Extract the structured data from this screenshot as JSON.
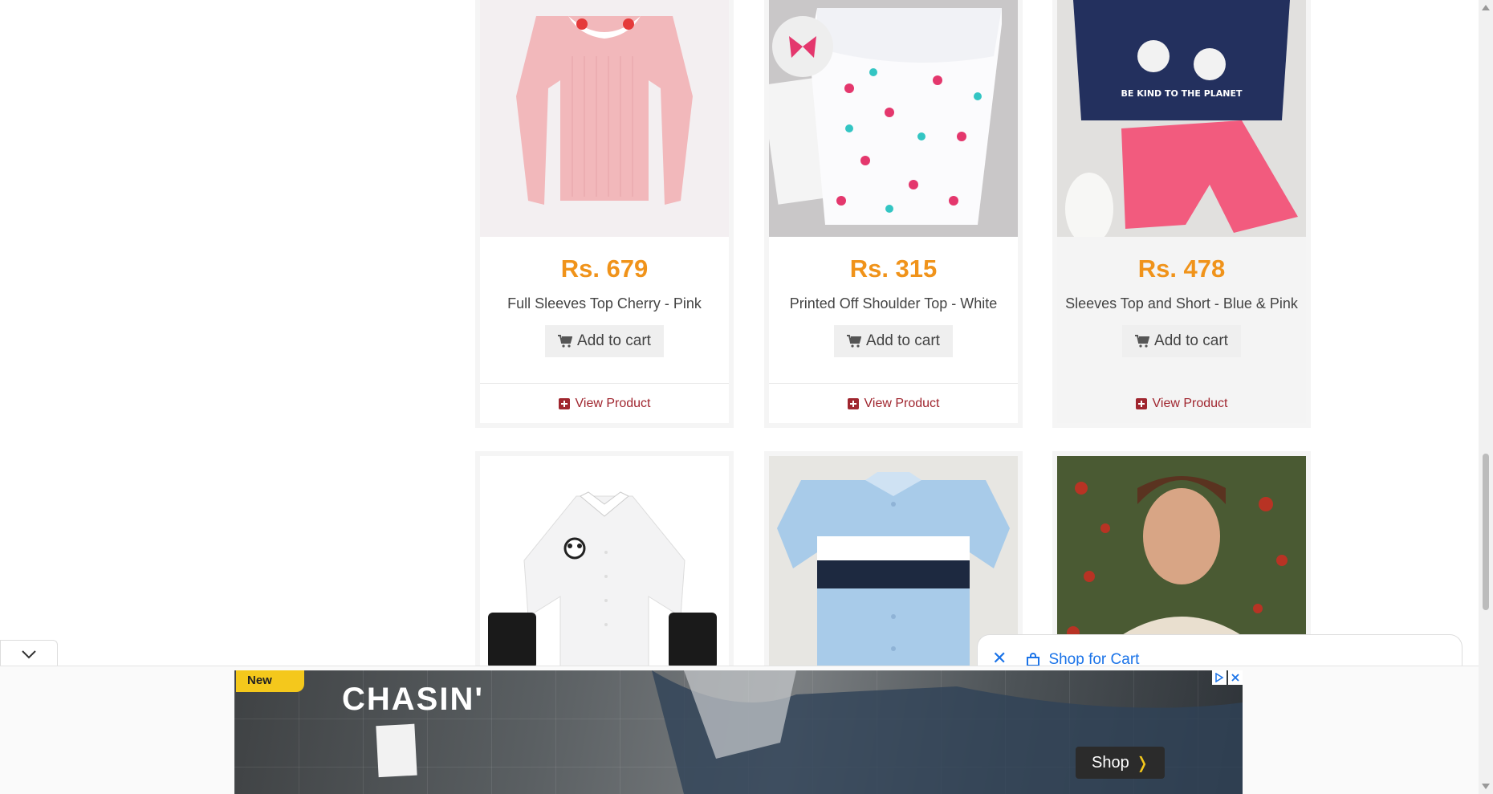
{
  "products": [
    {
      "price": "Rs. 679",
      "name": "Full Sleeves Top Cherry - Pink",
      "cart_label": "Add to cart",
      "view_label": "View Product"
    },
    {
      "price": "Rs. 315",
      "name": "Printed Off Shoulder Top - White",
      "cart_label": "Add to cart",
      "view_label": "View Product"
    },
    {
      "price": "Rs. 478",
      "name": "Sleeves Top and Short - Blue & Pink",
      "cart_label": "Add to cart",
      "view_label": "View Product"
    }
  ],
  "ad": {
    "badge": "New",
    "headline": "CHASIN'",
    "cta": "Shop"
  },
  "shop_bar": {
    "label": "Shop for Cart"
  },
  "colors": {
    "price": "#f0931a",
    "link": "#a0262f",
    "accent": "#1a73e8"
  },
  "icons": [
    "cart-icon",
    "plus-square-icon",
    "close-icon",
    "shopping-bag-icon",
    "chevron-down-icon"
  ]
}
